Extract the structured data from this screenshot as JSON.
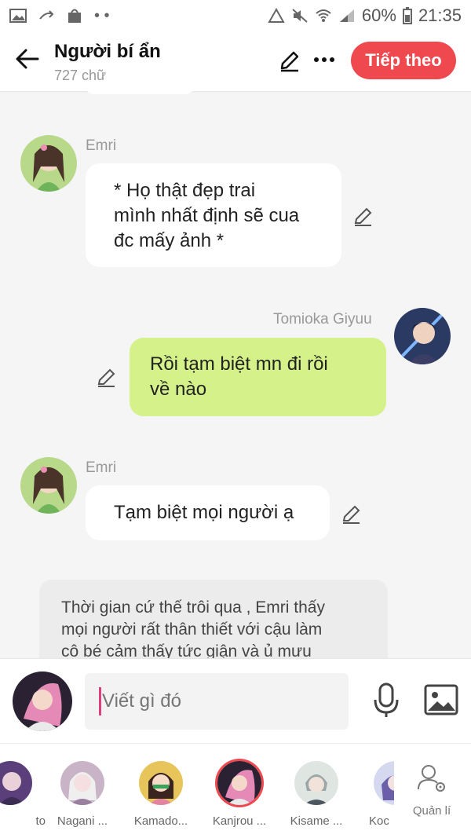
{
  "status_bar": {
    "battery": "60%",
    "time": "21:35"
  },
  "header": {
    "title": "Người bí ẩn",
    "subtitle": "727 chữ",
    "follow_label": "Tiếp theo"
  },
  "messages": [
    {
      "sender": "Emri",
      "text_lines": [
        "* Họ thật đẹp trai",
        "mình nhất định sẽ cua",
        "đc mấy ảnh *"
      ]
    },
    {
      "sender": "Tomioka Giyuu",
      "text_lines": [
        "Rồi tạm biệt mn đi rồi",
        "về nào"
      ]
    },
    {
      "sender": "Emri",
      "text_lines": [
        "Tạm biệt mọi người ạ"
      ]
    }
  ],
  "narration": {
    "lines": [
      "Thời gian cứ thế trôi qua , Emri thấy",
      "mọi người rất thân thiết với cậu làm",
      "cô bé cảm thấy tức giận và ủ mưu"
    ]
  },
  "input": {
    "placeholder": "Viết gì đó"
  },
  "characters": [
    {
      "name": "to"
    },
    {
      "name": "Nagani ..."
    },
    {
      "name": "Kamado..."
    },
    {
      "name": "Kanjrou ..."
    },
    {
      "name": "Kisame ..."
    },
    {
      "name": "Koc"
    }
  ],
  "manage_label": "Quản lí",
  "colors": {
    "accent": "#f0484f",
    "bubble_green": "#d4f18a",
    "caret": "#e0407e"
  }
}
